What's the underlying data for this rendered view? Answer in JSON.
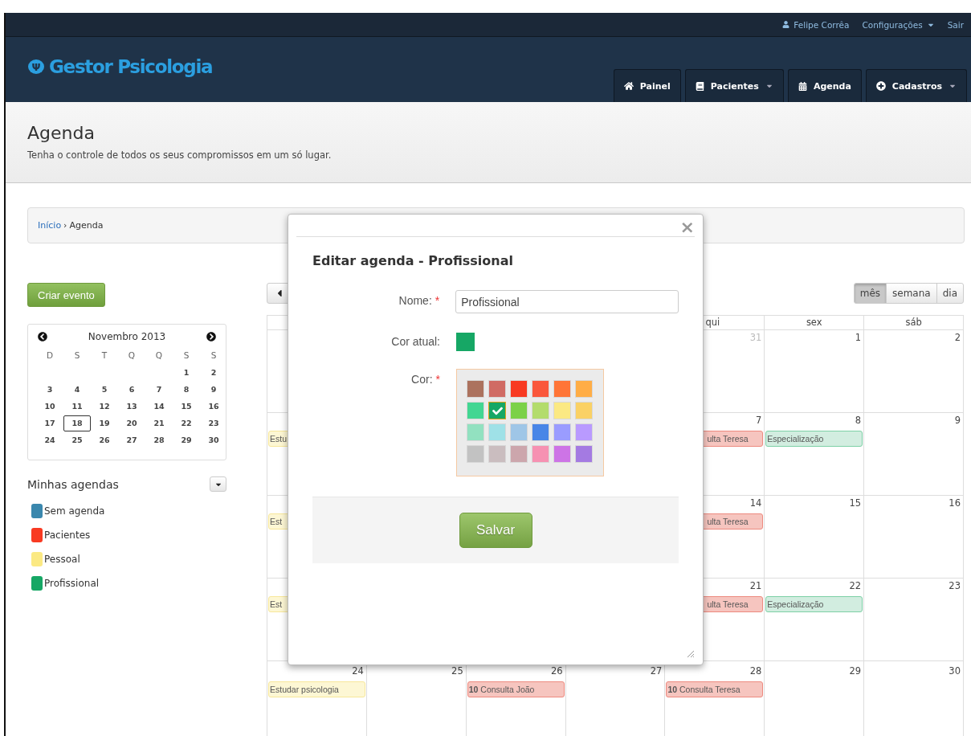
{
  "top_bar": {
    "user": "Felipe Corrêa",
    "settings": "Configurações",
    "logout": "Sair"
  },
  "header": {
    "logo_symbol": "Ψ",
    "logo": "Gestor Psicologia",
    "nav": [
      {
        "label": "Painel",
        "dropdown": false
      },
      {
        "label": "Pacientes",
        "dropdown": true
      },
      {
        "label": "Agenda",
        "dropdown": false
      },
      {
        "label": "Cadastros",
        "dropdown": true
      }
    ]
  },
  "page": {
    "title": "Agenda",
    "subtitle": "Tenha o controle de todos os seus compromissos em um só lugar."
  },
  "breadcrumb": {
    "link": "Início",
    "separator": "›",
    "current": "Agenda"
  },
  "sidebar": {
    "create_button": "Criar evento",
    "mini_calendar": {
      "title": "Novembro 2013",
      "weekdays": [
        "D",
        "S",
        "T",
        "Q",
        "Q",
        "S",
        "S"
      ],
      "weeks": [
        [
          {
            "d": "1",
            "selected": false
          },
          {
            "d": "2",
            "selected": false
          }
        ],
        [
          {
            "d": "3",
            "selected": false
          },
          {
            "d": "4",
            "selected": false
          },
          {
            "d": "5",
            "selected": false
          },
          {
            "d": "6",
            "selected": false
          },
          {
            "d": "7",
            "selected": false
          },
          {
            "d": "8",
            "selected": false
          },
          {
            "d": "9",
            "selected": false
          }
        ],
        [
          {
            "d": "10",
            "selected": false
          },
          {
            "d": "11",
            "selected": false
          },
          {
            "d": "12",
            "selected": false
          },
          {
            "d": "13",
            "selected": false
          },
          {
            "d": "14",
            "selected": false
          },
          {
            "d": "15",
            "selected": false
          },
          {
            "d": "16",
            "selected": false
          }
        ],
        [
          {
            "d": "17",
            "selected": false
          },
          {
            "d": "18",
            "selected": true
          },
          {
            "d": "19",
            "selected": false
          },
          {
            "d": "20",
            "selected": false
          },
          {
            "d": "21",
            "selected": false
          },
          {
            "d": "22",
            "selected": false
          },
          {
            "d": "23",
            "selected": false
          }
        ],
        [
          {
            "d": "24",
            "selected": false
          },
          {
            "d": "25",
            "selected": false
          },
          {
            "d": "26",
            "selected": false
          },
          {
            "d": "27",
            "selected": false
          },
          {
            "d": "28",
            "selected": false
          },
          {
            "d": "29",
            "selected": false
          },
          {
            "d": "30",
            "selected": false
          }
        ]
      ]
    },
    "agendas_title": "Minhas agendas",
    "agendas": [
      {
        "name": "Sem agenda",
        "color": "#3a87ad"
      },
      {
        "name": "Pacientes",
        "color": "#f83a22"
      },
      {
        "name": "Pessoal",
        "color": "#fbe983"
      },
      {
        "name": "Profissional",
        "color": "#16a765"
      }
    ]
  },
  "calendar": {
    "views": [
      {
        "label": "mês",
        "selected": true
      },
      {
        "label": "semana",
        "selected": false
      },
      {
        "label": "dia",
        "selected": false
      }
    ],
    "weekday_headers": [
      "qui",
      "sex",
      "sáb"
    ],
    "weeks": [
      {
        "qui": {
          "day": "31",
          "other_month": true
        },
        "sex": {
          "day": "1",
          "other_month": false
        },
        "sab": {
          "day": "2",
          "other_month": false
        }
      },
      {
        "dom": {
          "events": [
            {
              "text": "Estu",
              "kind": "pessoal"
            }
          ]
        },
        "qui": {
          "day": "7",
          "other_month": false,
          "events": [
            {
              "text": "ulta Teresa",
              "kind": "pacientes"
            }
          ]
        },
        "sex": {
          "day": "8",
          "other_month": false,
          "events": [
            {
              "text": "Especialização",
              "kind": "profissional"
            }
          ]
        },
        "sab": {
          "day": "9",
          "other_month": false
        }
      },
      {
        "dom": {
          "events": [
            {
              "text": "Est",
              "kind": "pessoal"
            }
          ]
        },
        "qui": {
          "day": "14",
          "other_month": false,
          "events": [
            {
              "text": "ulta Teresa",
              "kind": "pacientes"
            }
          ]
        },
        "sex": {
          "day": "15",
          "other_month": false
        },
        "sab": {
          "day": "16",
          "other_month": false
        }
      },
      {
        "dom": {
          "events": [
            {
              "text": "Est",
              "kind": "pessoal"
            }
          ]
        },
        "qui": {
          "day": "21",
          "other_month": false,
          "events": [
            {
              "text": "ulta Teresa",
              "kind": "pacientes"
            }
          ]
        },
        "sex": {
          "day": "22",
          "other_month": false,
          "events": [
            {
              "text": "Especialização",
              "kind": "profissional"
            }
          ]
        },
        "sab": {
          "day": "23",
          "other_month": false
        }
      },
      {
        "dom": {
          "day": "24",
          "other_month": false,
          "events": [
            {
              "text": "Estudar psicologia",
              "kind": "pessoal"
            }
          ]
        },
        "seg": {
          "day": "25",
          "other_month": false
        },
        "ter": {
          "day": "26",
          "other_month": false,
          "events": [
            {
              "text": "**10** Consulta João",
              "kind": "pacientes"
            }
          ]
        },
        "qua": {
          "day": "27",
          "other_month": false
        },
        "qui": {
          "day": "28",
          "other_month": false,
          "events": [
            {
              "text": "**10** Consulta Teresa",
              "kind": "pacientes"
            }
          ]
        },
        "sex": {
          "day": "29",
          "other_month": false
        },
        "sab": {
          "day": "30",
          "other_month": false
        }
      }
    ]
  },
  "modal": {
    "close": "×",
    "title": "Editar agenda - Profissional",
    "name_label": "Nome:",
    "required_mark": "*",
    "name_value": "Profissional",
    "current_color_label": "Cor atual:",
    "color_label": "Cor:",
    "palette": [
      {
        "color": "#ac725e",
        "selected": false
      },
      {
        "color": "#d06b64",
        "selected": false
      },
      {
        "color": "#f83a22",
        "selected": false
      },
      {
        "color": "#fa573c",
        "selected": false
      },
      {
        "color": "#ff7537",
        "selected": false
      },
      {
        "color": "#ffad46",
        "selected": false
      },
      {
        "color": "#42d692",
        "selected": false
      },
      {
        "color": "#16a765",
        "selected": true
      },
      {
        "color": "#7bd148",
        "selected": false
      },
      {
        "color": "#b3dc6c",
        "selected": false
      },
      {
        "color": "#fbe983",
        "selected": false
      },
      {
        "color": "#fad165",
        "selected": false
      },
      {
        "color": "#92e1c0",
        "selected": false
      },
      {
        "color": "#9fe1e7",
        "selected": false
      },
      {
        "color": "#9fc6e7",
        "selected": false
      },
      {
        "color": "#4986e7",
        "selected": false
      },
      {
        "color": "#9a9cff",
        "selected": false
      },
      {
        "color": "#b99aff",
        "selected": false
      },
      {
        "color": "#c2c2c2",
        "selected": false
      },
      {
        "color": "#cabdbf",
        "selected": false
      },
      {
        "color": "#cca6ac",
        "selected": false
      },
      {
        "color": "#f691b2",
        "selected": false
      },
      {
        "color": "#cd74e6",
        "selected": false
      },
      {
        "color": "#a47ae2",
        "selected": false
      }
    ],
    "save": "Salvar"
  }
}
